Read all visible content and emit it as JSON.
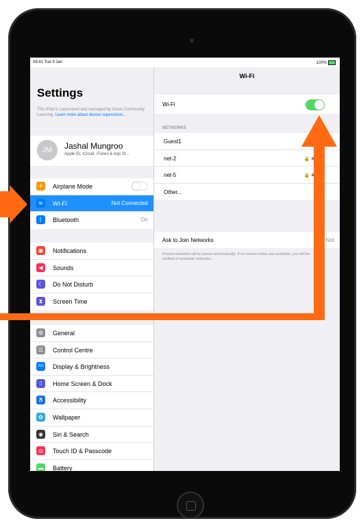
{
  "status_bar": {
    "time": "09:41  Tue 9 Jan",
    "battery": "100%"
  },
  "sidebar": {
    "title": "Settings",
    "supervision_text": "This iPad is supervised and managed by Oasis Community Learning. ",
    "supervision_link": "Learn more about device supervision...",
    "profile": {
      "initials": "JM",
      "name": "Jashal Mungroo",
      "subtitle": "Apple ID, iCloud, iTunes & App St..."
    },
    "group1": [
      {
        "label": "Airplane Mode",
        "icon": "airplane-icon",
        "color": "#ff9500"
      },
      {
        "label": "Wi-Fi",
        "value": "Not Connected",
        "icon": "wifi-icon",
        "color": "#007aff"
      },
      {
        "label": "Bluetooth",
        "value": "On",
        "icon": "bluetooth-icon",
        "color": "#007aff"
      }
    ],
    "group2": [
      {
        "label": "Notifications",
        "icon": "notifications-icon",
        "color": "#ff3b30"
      },
      {
        "label": "Sounds",
        "icon": "sounds-icon",
        "color": "#ff2d55"
      },
      {
        "label": "Do Not Disturb",
        "icon": "moon-icon",
        "color": "#5856d6"
      },
      {
        "label": "Screen Time",
        "icon": "hourglass-icon",
        "color": "#5856d6"
      }
    ],
    "group3": [
      {
        "label": "General",
        "icon": "gear-icon",
        "color": "#8e8e93"
      },
      {
        "label": "Control Centre",
        "icon": "control-centre-icon",
        "color": "#8e8e93"
      },
      {
        "label": "Display & Brightness",
        "icon": "display-icon",
        "color": "#007aff"
      },
      {
        "label": "Home Screen & Dock",
        "icon": "home-screen-icon",
        "color": "#5856d6"
      },
      {
        "label": "Accessibility",
        "icon": "accessibility-icon",
        "color": "#007aff"
      },
      {
        "label": "Wallpaper",
        "icon": "wallpaper-icon",
        "color": "#34aadc"
      },
      {
        "label": "Siri & Search",
        "icon": "siri-icon",
        "color": "#333333"
      },
      {
        "label": "Touch ID & Passcode",
        "icon": "fingerprint-icon",
        "color": "#ff2d55"
      },
      {
        "label": "Battery",
        "icon": "battery-icon",
        "color": "#4cd964"
      }
    ]
  },
  "detail": {
    "title": "Wi-Fi",
    "wifi_label": "Wi-Fi",
    "wifi_on": true,
    "networks_header": "NETWORKS",
    "networks": [
      {
        "name": "Guest1",
        "locked": true
      },
      {
        "name": "net-2",
        "locked": true
      },
      {
        "name": "net-5",
        "locked": true
      },
      {
        "name": "Other...",
        "locked": false
      }
    ],
    "ask_label": "Ask to Join Networks",
    "ask_value": "Not",
    "ask_note": "Known networks will be joined automatically. If no known netwo are available, you will be notified of available networks."
  },
  "annotation": {
    "arrow_color": "#ff6a13"
  }
}
